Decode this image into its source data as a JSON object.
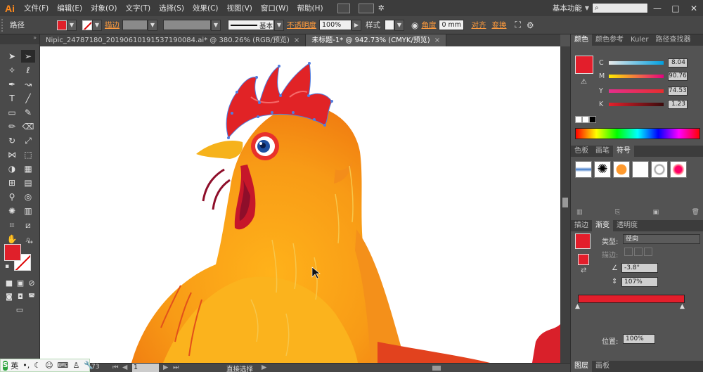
{
  "app": {
    "logo": "Ai",
    "menus": [
      "文件(F)",
      "编辑(E)",
      "对象(O)",
      "文字(T)",
      "选择(S)",
      "效果(C)",
      "视图(V)",
      "窗口(W)",
      "帮助(H)"
    ],
    "workspace": "基本功能"
  },
  "control": {
    "object_type": "路径",
    "stroke_label": "描边",
    "stroke_style": "基本",
    "opacity_label": "不透明度",
    "opacity_value": "100%",
    "style_label": "样式",
    "corner_label": "角度",
    "corner_value": "0 mm",
    "align_label": "对齐",
    "transform_label": "变换"
  },
  "tabs": [
    {
      "label": "Nipic_24787180_20190610191537190084.ai* @ 380.26% (RGB/预览)",
      "active": false
    },
    {
      "label": "未标题-1* @ 942.73% (CMYK/预览)",
      "active": true
    }
  ],
  "color_panel": {
    "tabs": [
      "颜色",
      "颜色参考",
      "Kuler",
      "路径查找器"
    ],
    "channels": [
      {
        "label": "C",
        "value": "8.04",
        "gradient": "#e8e8e8,#00a0e0"
      },
      {
        "label": "M",
        "value": "90.76",
        "gradient": "#ffeb00,#e4007f"
      },
      {
        "label": "Y",
        "value": "74.53",
        "gradient": "#e52e8c,#e62e2e"
      },
      {
        "label": "K",
        "value": "1.23",
        "gradient": "#e5212c,#3a0b0c"
      }
    ],
    "fill_color": "#e31e2b"
  },
  "symbols_panel": {
    "tabs": [
      "色板",
      "画笔",
      "符号"
    ]
  },
  "gradient_panel": {
    "tabs": [
      "描边",
      "渐变",
      "透明度"
    ],
    "type_label": "类型:",
    "type_value": "径向",
    "stroke_label": "描边:",
    "angle_value": "-3.8°",
    "ratio_value": "107%",
    "location_label": "位置:",
    "location_value": "100%"
  },
  "layers_panel": {
    "tabs": [
      "图层",
      "画板"
    ]
  },
  "status": {
    "zoom_value": "73",
    "page_value": "1",
    "tool_name": "直接选择"
  },
  "ime": {
    "lang": "英"
  },
  "colors": {
    "accent_orange": "#ff8a1d",
    "fill_red": "#e0202a"
  }
}
